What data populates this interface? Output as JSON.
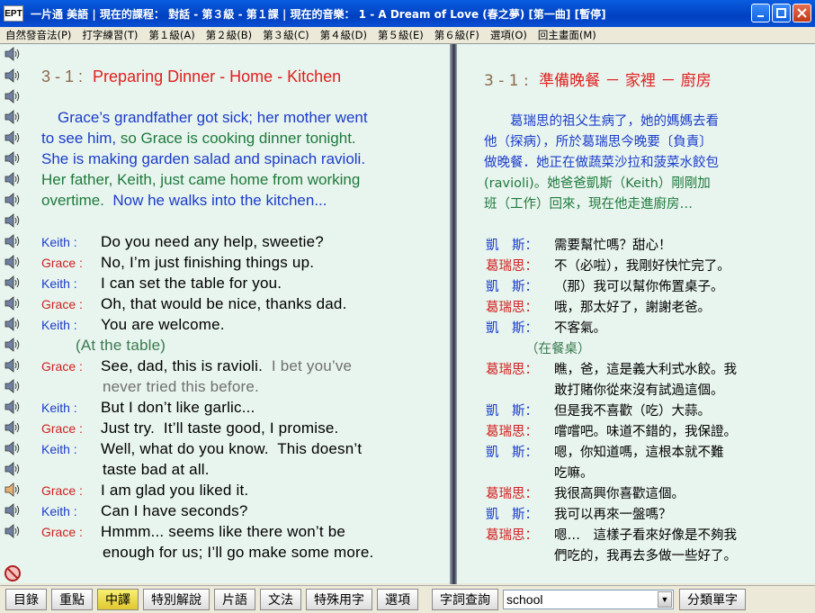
{
  "window": {
    "app_badge": "EPT",
    "title": "一片通 美語 | 現在的課程： 對話 - 第３級 - 第１課 | 現在的音樂： 1 - A Dream of Love (春之夢) [第一曲] [暫停]"
  },
  "menu": [
    "自然發音法(P)",
    "打字練習(T)",
    "第１級(A)",
    "第２級(B)",
    "第３級(C)",
    "第４級(D)",
    "第５級(E)",
    "第６級(F)",
    "選項(O)",
    "回主畫面(M)"
  ],
  "english": {
    "lesson_num": "3 - 1 :",
    "lesson_title": "Preparing Dinner - Home - Kitchen",
    "intro": [
      {
        "text": "Grace’s grandfather got sick; her mother went",
        "color": "blue"
      },
      {
        "text": "to see him,",
        "color": "blue",
        "rest": " so Grace is cooking dinner tonight.",
        "rest_color": "green"
      },
      {
        "text": "She is making garden salad and spinach ravioli.",
        "color": "blue"
      },
      {
        "text": "Her father, Keith, just came home from working",
        "color": "green"
      },
      {
        "text": "overtime.",
        "color": "green",
        "rest": "  Now he walks into the kitchen...",
        "rest_color": "blue"
      }
    ],
    "dialogue": [
      {
        "speaker": "Keith :",
        "line": "Do you need any help, sweetie?"
      },
      {
        "speaker": "Grace :",
        "line": "No, I’m just finishing things up."
      },
      {
        "speaker": "Keith :",
        "line": "I can set the table for you."
      },
      {
        "speaker": "Grace :",
        "line": "Oh, that would be nice, thanks dad."
      },
      {
        "speaker": "Keith :",
        "line": "You are welcome."
      },
      {
        "speaker": "",
        "line": "(At the table)"
      },
      {
        "speaker": "Grace :",
        "line": "See, dad, this is ravioli.",
        "extra": "  I bet you’ve"
      },
      {
        "speaker": "",
        "line": "never tried this before."
      },
      {
        "speaker": "Keith :",
        "line": "But I don’t like garlic..."
      },
      {
        "speaker": "Grace :",
        "line": "Just try.  It’ll taste good, I promise."
      },
      {
        "speaker": "Keith :",
        "line": "Well, what do you know.  This doesn’t"
      },
      {
        "speaker": "",
        "line": "taste bad at all."
      },
      {
        "speaker": "Grace :",
        "line": "I am glad you liked it."
      },
      {
        "speaker": "Keith :",
        "line": "Can I have seconds?"
      },
      {
        "speaker": "Grace :",
        "line": "Hmmm... seems like there won’t be"
      },
      {
        "speaker": "",
        "line": "enough for us; I’ll go make some more."
      }
    ]
  },
  "chinese": {
    "lesson_num": "3 - 1 :",
    "lesson_title": "準備晚餐 － 家裡 － 廚房",
    "intro": [
      "　　葛瑞思的祖父生病了，她的媽媽去看",
      "他（探病），所於葛瑞思今晚要〔負責〕",
      "做晚餐．她正在做蔬菜沙拉和菠菜水餃包",
      "(ravioli)。她爸爸凱斯（Keith）剛剛加",
      "班（工作）回來，現在他走進廚房…"
    ],
    "dialogue": [
      {
        "speaker": "凱　斯：",
        "line": "需要幫忙嗎？甜心！"
      },
      {
        "speaker": "葛瑞思：",
        "line": "不（必啦），我剛好快忙完了。"
      },
      {
        "speaker": "凱　斯：",
        "line": "（那）我可以幫你佈置桌子。"
      },
      {
        "speaker": "葛瑞思：",
        "line": "哦，那太好了，謝謝老爸。"
      },
      {
        "speaker": "凱　斯：",
        "line": "不客氣。"
      },
      {
        "speaker": "",
        "line": "（在餐桌）"
      },
      {
        "speaker": "葛瑞思：",
        "line": "瞧，爸，這是義大利式水餃。我"
      },
      {
        "speaker": "",
        "line": "敢打賭你從來沒有試過這個。"
      },
      {
        "speaker": "凱　斯：",
        "line": "但是我不喜歡（吃）大蒜。"
      },
      {
        "speaker": "葛瑞思：",
        "line": "嚐嚐吧。味道不錯的，我保證。"
      },
      {
        "speaker": "凱　斯：",
        "line": "嗯，你知道嗎，這根本就不難"
      },
      {
        "speaker": "",
        "line": "吃嘛。"
      },
      {
        "speaker": "葛瑞思：",
        "line": "我很高興你喜歡這個。"
      },
      {
        "speaker": "凱　斯：",
        "line": "我可以再來一盤嗎？"
      },
      {
        "speaker": "葛瑞思：",
        "line": "嗯…　這樣子看來好像是不夠我"
      },
      {
        "speaker": "",
        "line": "們吃的，我再去多做一些好了。"
      }
    ]
  },
  "toolbar": {
    "buttons": [
      "目錄",
      "重點",
      "中譯",
      "特別解說",
      "片語",
      "文法",
      "特殊用字",
      "選項",
      "字詞查詢"
    ],
    "active": "中譯",
    "search_value": "school",
    "category_button": "分類單字"
  },
  "colors": {
    "keith": "#1a3ccc",
    "grace": "#d02020",
    "title_red": "#e02020",
    "narration_green": "#1e7a3c",
    "pane_bg": "#e8f4ee"
  }
}
